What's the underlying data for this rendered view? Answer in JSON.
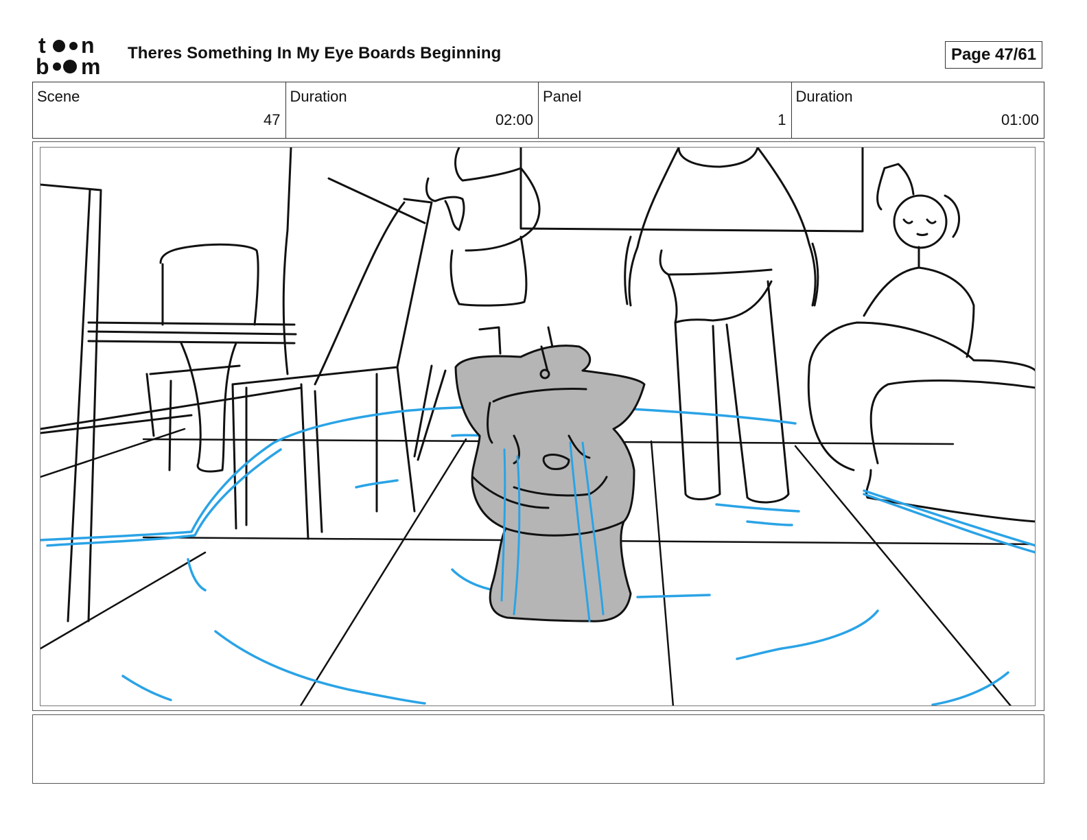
{
  "header": {
    "logo_text": "toonboom",
    "title": "Theres Something In My Eye Boards Beginning",
    "page": "Page 47/61"
  },
  "info": {
    "scene_label": "Scene",
    "scene_value": "47",
    "scene_duration_label": "Duration",
    "scene_duration_value": "02:00",
    "panel_label": "Panel",
    "panel_value": "1",
    "panel_duration_label": "Duration",
    "panel_duration_value": "01:00"
  },
  "notes": {
    "text": ""
  },
  "colors": {
    "ink": "#111111",
    "water": "#2aa3e6",
    "character_fill": "#b5b5b5"
  }
}
